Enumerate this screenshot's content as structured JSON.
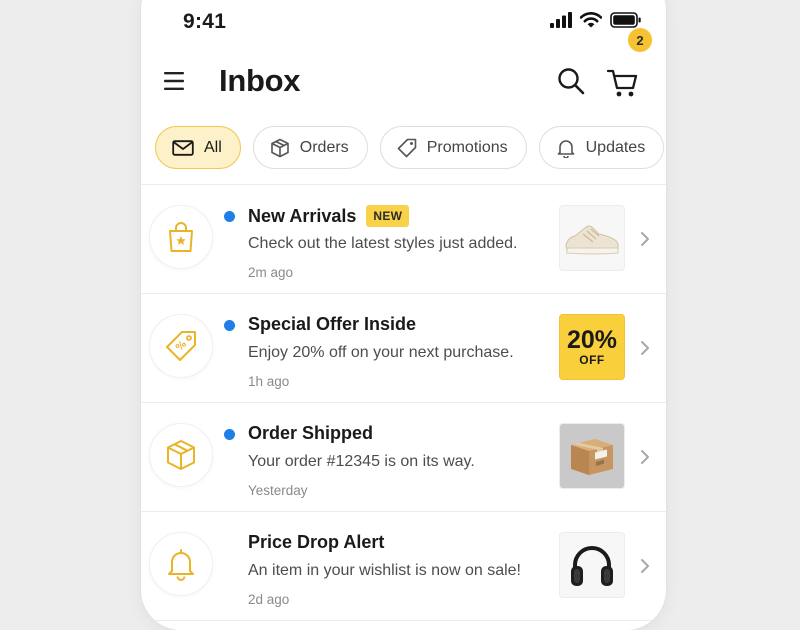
{
  "status": {
    "time": "9:41"
  },
  "header": {
    "title": "Inbox",
    "cart_count": "2"
  },
  "tabs": [
    {
      "label": "All",
      "icon": "mail-icon",
      "active": true
    },
    {
      "label": "Orders",
      "icon": "box-icon",
      "active": false
    },
    {
      "label": "Promotions",
      "icon": "tag-icon",
      "active": false
    },
    {
      "label": "Updates",
      "icon": "bell-icon",
      "active": false
    }
  ],
  "messages": [
    {
      "icon": "shopping-bag-icon",
      "title": "New Arrivals",
      "badge": "NEW",
      "body": "Check out the latest styles just added.",
      "time": "2m ago",
      "unread": true,
      "thumbnail": "sneaker-image"
    },
    {
      "icon": "discount-tag-icon",
      "title": "Special Offer Inside",
      "body": "Enjoy 20% off on your next purchase.",
      "time": "1h ago",
      "unread": true,
      "thumbnail": {
        "percent": "20%",
        "text": "OFF"
      }
    },
    {
      "icon": "package-icon",
      "title": "Order Shipped",
      "body": "Your order #12345 is on its way.",
      "time": "Yesterday",
      "unread": true,
      "thumbnail": "cardboard-box-image"
    },
    {
      "icon": "bell-icon",
      "title": "Price Drop Alert",
      "body": "An item in your wishlist is now on sale!",
      "time": "2d ago",
      "unread": false,
      "thumbnail": "headphones-image"
    }
  ],
  "colors": {
    "accent": "#f5c232",
    "unread": "#1f7ee8",
    "active_tab_bg": "#fdf1c9"
  }
}
